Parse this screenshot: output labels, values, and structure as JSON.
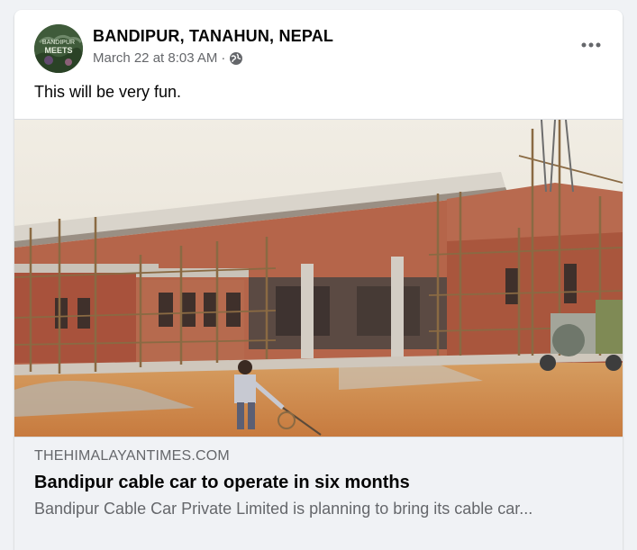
{
  "post": {
    "page_name": "BANDIPUR, TANAHUN, NEPAL",
    "timestamp": "March 22 at 8:03 AM",
    "separator": "·",
    "privacy_icon": "globe-icon",
    "more_icon": "more-horizontal-icon",
    "text": "This will be very fun.",
    "avatar": {
      "line1": "BANDIPUR",
      "line2": "MEETS"
    }
  },
  "link_preview": {
    "image_description_icon": "construction-photo",
    "domain": "THEHIMALAYANTIMES.COM",
    "headline": "Bandipur cable car to operate in six months",
    "description": "Bandipur Cable Car Private Limited is planning to bring its cable car..."
  },
  "colors": {
    "page_bg": "#f0f2f5",
    "card_bg": "#ffffff",
    "secondary_text": "#65676b",
    "primary_text": "#050505",
    "link_meta_bg": "#f0f2f5"
  }
}
